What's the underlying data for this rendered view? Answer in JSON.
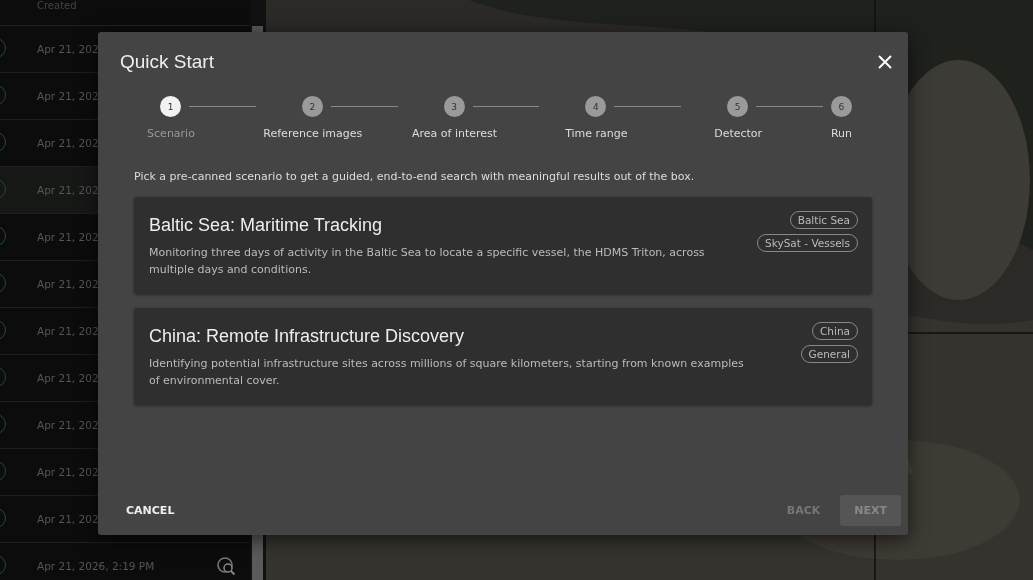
{
  "sidebar": {
    "header": "Created",
    "rows": [
      {
        "date": "Apr 21, 202",
        "selected": false
      },
      {
        "date": "Apr 21, 202",
        "selected": false
      },
      {
        "date": "Apr 21, 202",
        "selected": false
      },
      {
        "date": "Apr 21, 202",
        "selected": true
      },
      {
        "date": "Apr 21, 202",
        "selected": false
      },
      {
        "date": "Apr 21, 202",
        "selected": false
      },
      {
        "date": "Apr 21, 202",
        "selected": false
      },
      {
        "date": "Apr 21, 202",
        "selected": false
      },
      {
        "date": "Apr 21, 202",
        "selected": false
      },
      {
        "date": "Apr 21, 202",
        "selected": false
      },
      {
        "date": "Apr 21, 202",
        "selected": false
      },
      {
        "date": "Apr 21, 2026, 2:19 PM",
        "selected": false
      }
    ]
  },
  "dialog": {
    "title": "Quick Start",
    "steps": [
      {
        "number": "1",
        "label": "Scenario",
        "selected": true
      },
      {
        "number": "2",
        "label": "Reference images",
        "selected": false
      },
      {
        "number": "3",
        "label": "Area of interest",
        "selected": false
      },
      {
        "number": "4",
        "label": "Time range",
        "selected": false
      },
      {
        "number": "5",
        "label": "Detector",
        "selected": false
      },
      {
        "number": "6",
        "label": "Run",
        "selected": false
      }
    ],
    "intro": "Pick a pre-canned scenario to get a guided, end-to-end search with meaningful results out of the box.",
    "scenarios": [
      {
        "title": "Baltic Sea: Maritime Tracking",
        "description": "Monitoring three days of activity in the Baltic Sea to locate a specific vessel, the HDMS Triton, across multiple days and conditions.",
        "tags": [
          "Baltic Sea",
          "SkySat - Vessels"
        ]
      },
      {
        "title": "China: Remote Infrastructure Discovery",
        "description": "Identifying potential infrastructure sites across millions of square kilometers, starting from known examples of environmental cover.",
        "tags": [
          "China",
          "General"
        ]
      }
    ],
    "buttons": [
      {
        "label": "CANCEL",
        "kind": "text",
        "disabled": false
      },
      {
        "label": "BACK",
        "kind": "text",
        "disabled": true
      },
      {
        "label": "NEXT",
        "kind": "filled",
        "disabled": true
      }
    ]
  }
}
